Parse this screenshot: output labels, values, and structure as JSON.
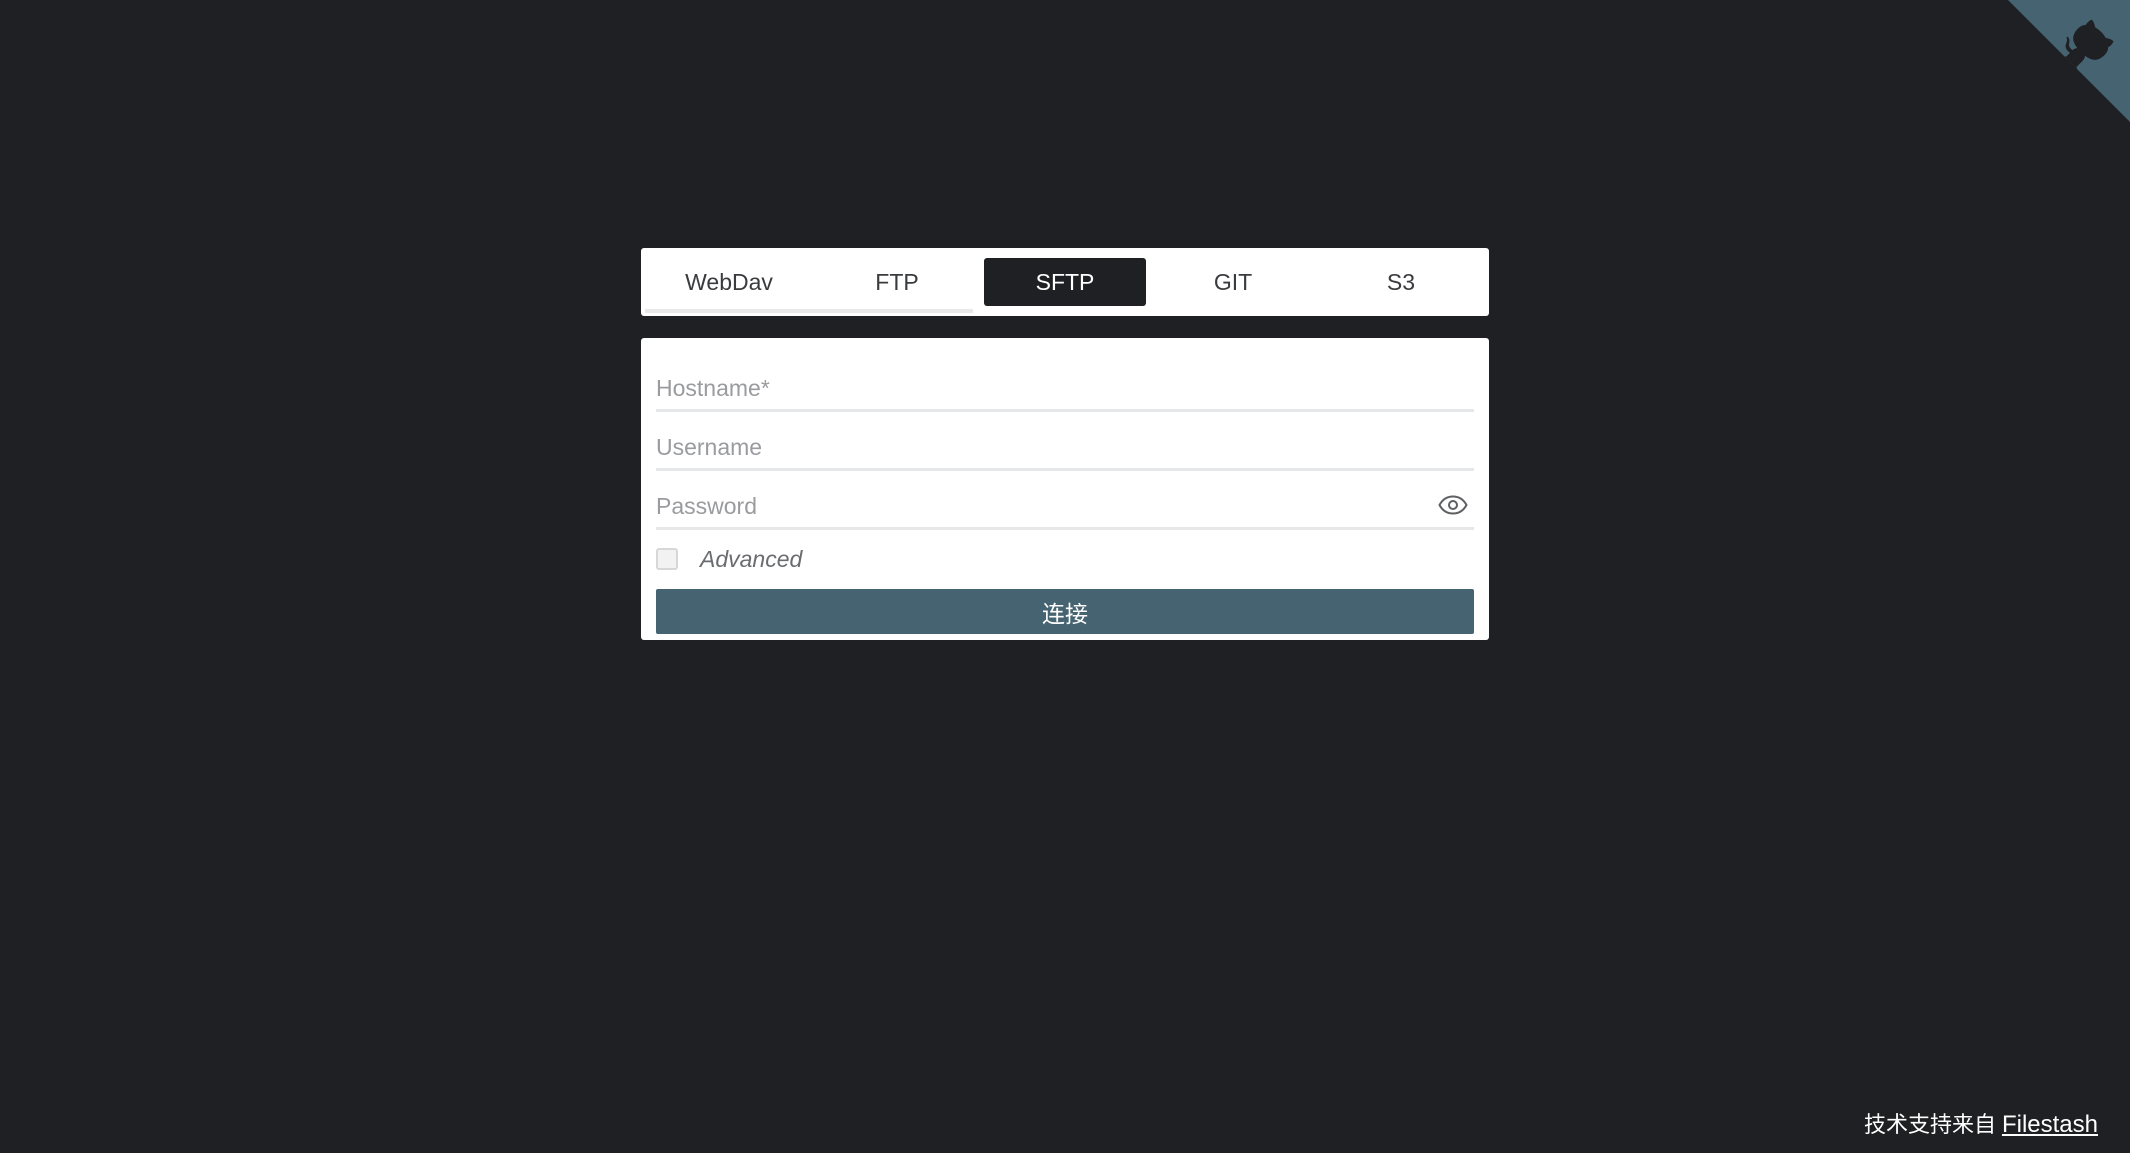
{
  "tabs": [
    {
      "label": "WebDav",
      "active": false
    },
    {
      "label": "FTP",
      "active": false
    },
    {
      "label": "SFTP",
      "active": true
    },
    {
      "label": "GIT",
      "active": false
    },
    {
      "label": "S3",
      "active": false
    }
  ],
  "form": {
    "hostname_placeholder": "Hostname*",
    "username_placeholder": "Username",
    "password_placeholder": "Password",
    "hostname_value": "",
    "username_value": "",
    "password_value": "",
    "advanced_label": "Advanced",
    "advanced_checked": false,
    "connect_label": "连接"
  },
  "footer": {
    "prefix": "技术支持来自",
    "link_label": "Filestash"
  },
  "colors": {
    "background": "#1f2023",
    "accent": "#466372",
    "active_tab": "#1f2023"
  },
  "icons": {
    "corner": "github-octocat-icon",
    "password_toggle": "eye-icon"
  }
}
